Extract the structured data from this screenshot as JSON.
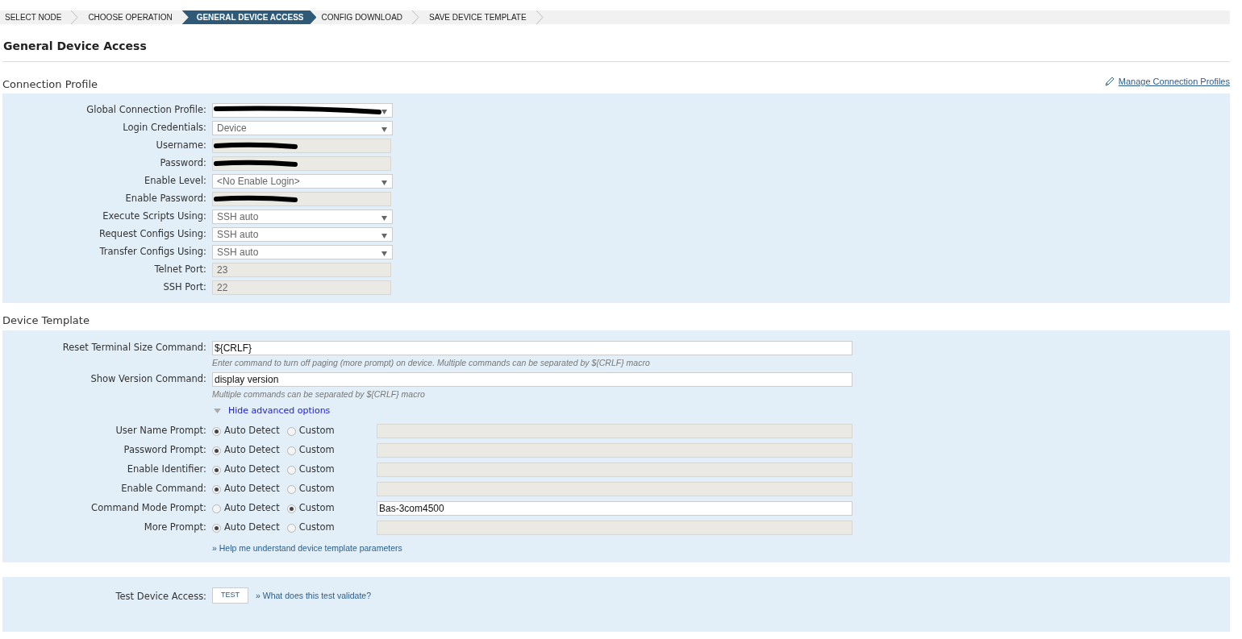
{
  "steps": [
    {
      "label": "SELECT NODE",
      "selected": false
    },
    {
      "label": "CHOOSE OPERATION",
      "selected": false
    },
    {
      "label": "GENERAL DEVICE ACCESS",
      "selected": true
    },
    {
      "label": "CONFIG DOWNLOAD",
      "selected": false
    },
    {
      "label": "SAVE DEVICE TEMPLATE",
      "selected": false
    }
  ],
  "title": "General Device Access",
  "connection_profile": {
    "heading": "Connection Profile",
    "manage_link": "Manage Connection Profiles",
    "fields": [
      {
        "label": "Global Connection Profile:",
        "kind": "select",
        "redacted": true
      },
      {
        "label": "Login Credentials:",
        "kind": "select",
        "value": "Device",
        "redacted": false
      },
      {
        "label": "Username:",
        "kind": "readonly",
        "redacted": true
      },
      {
        "label": "Password:",
        "kind": "readonly",
        "redacted": true
      },
      {
        "label": "Enable Level:",
        "kind": "select",
        "value": "<No Enable Login>",
        "redacted": false
      },
      {
        "label": "Enable Password:",
        "kind": "readonly",
        "redacted": true
      },
      {
        "label": "Execute Scripts Using:",
        "kind": "select",
        "value": "SSH auto",
        "redacted": false
      },
      {
        "label": "Request Configs Using:",
        "kind": "select",
        "value": "SSH auto",
        "redacted": false
      },
      {
        "label": "Transfer Configs Using:",
        "kind": "select",
        "value": "SSH auto",
        "redacted": false
      },
      {
        "label": "Telnet Port:",
        "kind": "readonly",
        "value": "23",
        "redacted": false
      },
      {
        "label": "SSH Port:",
        "kind": "readonly",
        "value": "22",
        "redacted": false
      }
    ]
  },
  "device_template": {
    "heading": "Device Template",
    "commands": [
      {
        "label": "Reset Terminal Size Command:",
        "value": "${CRLF}",
        "hint": "Enter command to turn off paging (more prompt) on device. Multiple commands can be separated by ${CRLF} macro"
      },
      {
        "label": "Show Version Command:",
        "value": "display version",
        "hint": "Multiple commands can be separated by ${CRLF} macro"
      }
    ],
    "advanced_toggle": {
      "label": "Hide advanced options",
      "expanded": true
    },
    "prompts": [
      {
        "label": "User Name Prompt:",
        "options": [
          {
            "label": "Auto Detect",
            "selected": true
          },
          {
            "label": "Custom",
            "selected": false
          }
        ]
      },
      {
        "label": "Password Prompt:",
        "options": [
          {
            "label": "Auto Detect",
            "selected": true
          },
          {
            "label": "Custom",
            "selected": false
          }
        ]
      },
      {
        "label": "Enable Identifier:",
        "options": [
          {
            "label": "Auto Detect",
            "selected": true
          },
          {
            "label": "Custom",
            "selected": false
          }
        ]
      },
      {
        "label": "Enable Command:",
        "options": [
          {
            "label": "Auto Detect",
            "selected": true
          },
          {
            "label": "Custom",
            "selected": false
          }
        ]
      },
      {
        "label": "Command Mode Prompt:",
        "options": [
          {
            "label": "Auto Detect",
            "selected": false
          },
          {
            "label": "Custom",
            "selected": true
          }
        ],
        "value": "Bas-3com4500"
      },
      {
        "label": "More Prompt:",
        "options": [
          {
            "label": "Auto Detect",
            "selected": true
          },
          {
            "label": "Custom",
            "selected": false
          }
        ]
      }
    ],
    "help_link": "» Help me understand device template parameters"
  },
  "test": {
    "label": "Test Device Access:",
    "button": "TEST",
    "link": "» What does this test validate?"
  }
}
